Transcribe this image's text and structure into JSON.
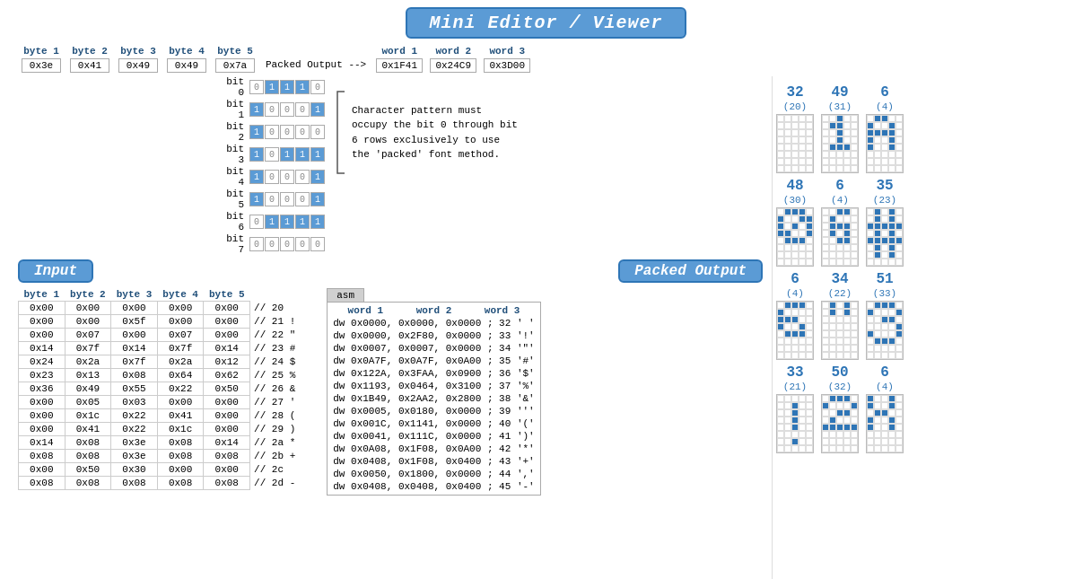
{
  "title": "Mini Editor / Viewer",
  "header": {
    "byte_labels": [
      "byte 1",
      "byte 2",
      "byte 3",
      "byte 4",
      "byte 5"
    ],
    "byte_values": [
      "0x3e",
      "0x41",
      "0x49",
      "0x49",
      "0x7a"
    ],
    "packed_arrow": "Packed Output -->",
    "word_labels": [
      "word 1",
      "word 2",
      "word 3"
    ],
    "word_values": [
      "0x1F41",
      "0x24C9",
      "0x3D00"
    ]
  },
  "bit_grid": {
    "rows": [
      {
        "label": "bit 0",
        "cells": [
          0,
          1,
          1,
          1,
          0
        ]
      },
      {
        "label": "bit 1",
        "cells": [
          1,
          0,
          0,
          0,
          1
        ]
      },
      {
        "label": "bit 2",
        "cells": [
          1,
          0,
          0,
          0,
          0
        ]
      },
      {
        "label": "bit 3",
        "cells": [
          1,
          0,
          1,
          1,
          1
        ]
      },
      {
        "label": "bit 4",
        "cells": [
          1,
          0,
          0,
          0,
          1
        ]
      },
      {
        "label": "bit 5",
        "cells": [
          1,
          0,
          0,
          0,
          1
        ]
      },
      {
        "label": "bit 6",
        "cells": [
          0,
          1,
          1,
          1,
          1
        ]
      },
      {
        "label": "bit 7",
        "cells": [
          0,
          0,
          0,
          0,
          0
        ]
      }
    ]
  },
  "annotation": "Character pattern must occupy the bit 0 through bit 6 rows exclusively to use the 'packed' font method.",
  "input_label": "Input",
  "packed_output_label": "Packed Output",
  "input_table": {
    "col_headers": [
      "byte 1",
      "byte 2",
      "byte 3",
      "byte 4",
      "byte 5"
    ],
    "rows": [
      [
        "0x00",
        "0x00",
        "0x00",
        "0x00",
        "0x00",
        "// 20"
      ],
      [
        "0x00",
        "0x00",
        "0x5f",
        "0x00",
        "0x00",
        "// 21 !"
      ],
      [
        "0x00",
        "0x07",
        "0x00",
        "0x07",
        "0x00",
        "// 22 \""
      ],
      [
        "0x14",
        "0x7f",
        "0x14",
        "0x7f",
        "0x14",
        "// 23 #"
      ],
      [
        "0x24",
        "0x2a",
        "0x7f",
        "0x2a",
        "0x12",
        "// 24 $"
      ],
      [
        "0x23",
        "0x13",
        "0x08",
        "0x64",
        "0x62",
        "// 25 %"
      ],
      [
        "0x36",
        "0x49",
        "0x55",
        "0x22",
        "0x50",
        "// 26 &"
      ],
      [
        "0x00",
        "0x05",
        "0x03",
        "0x00",
        "0x00",
        "// 27 '"
      ],
      [
        "0x00",
        "0x1c",
        "0x22",
        "0x41",
        "0x00",
        "// 28 ("
      ],
      [
        "0x00",
        "0x41",
        "0x22",
        "0x1c",
        "0x00",
        "// 29 )"
      ],
      [
        "0x14",
        "0x08",
        "0x3e",
        "0x08",
        "0x14",
        "// 2a *"
      ],
      [
        "0x08",
        "0x08",
        "0x3e",
        "0x08",
        "0x08",
        "// 2b +"
      ],
      [
        "0x00",
        "0x50",
        "0x30",
        "0x00",
        "0x00",
        "// 2c"
      ],
      [
        "0x08",
        "0x08",
        "0x08",
        "0x08",
        "0x08",
        "// 2d -"
      ]
    ]
  },
  "packed_table": {
    "col_headers": [
      "word 1",
      "word 2",
      "word 3"
    ],
    "rows": [
      "dw 0x0000, 0x0000, 0x0000 ; 32 ' '",
      "dw 0x0000, 0x2F80, 0x0000 ; 33 '!'",
      "dw 0x0007, 0x0007, 0x0000 ; 34 '\"'",
      "dw 0x0A7F, 0x0A7F, 0x0A00 ; 35 '#'",
      "dw 0x122A, 0x3FAA, 0x0900 ; 36 '$'",
      "dw 0x1193, 0x0464, 0x3100 ; 37 '%'",
      "dw 0x1B49, 0x2AA2, 0x2800 ; 38 '&'",
      "dw 0x0005, 0x0180, 0x0000 ; 39 '''",
      "dw 0x001C, 0x1141, 0x0000 ; 40 '('",
      "dw 0x0041, 0x111C, 0x0000 ; 41 ')'",
      "dw 0x0A08, 0x1F08, 0x0A00 ; 42 '*'",
      "dw 0x0408, 0x1F08, 0x0400 ; 43 '+'",
      "dw 0x0050, 0x1800, 0x0000 ; 44 ','",
      "dw 0x0408, 0x0408, 0x0400 ; 45 '-'"
    ]
  },
  "char_previews": [
    {
      "label": "32",
      "sub": "(20)",
      "pixels": [
        [
          0,
          0,
          0,
          0,
          0
        ],
        [
          0,
          0,
          0,
          0,
          0
        ],
        [
          0,
          0,
          0,
          0,
          0
        ],
        [
          0,
          0,
          0,
          0,
          0
        ],
        [
          0,
          0,
          0,
          0,
          0
        ],
        [
          0,
          0,
          0,
          0,
          0
        ],
        [
          0,
          0,
          0,
          0,
          0
        ],
        [
          0,
          0,
          0,
          0,
          0
        ]
      ]
    },
    {
      "label": "48",
      "sub": "(30)",
      "pixels": [
        [
          0,
          1,
          1,
          1,
          0
        ],
        [
          1,
          0,
          0,
          1,
          1
        ],
        [
          1,
          0,
          1,
          0,
          1
        ],
        [
          1,
          1,
          0,
          0,
          1
        ],
        [
          0,
          1,
          1,
          1,
          0
        ],
        [
          0,
          0,
          0,
          0,
          0
        ],
        [
          0,
          0,
          0,
          0,
          0
        ],
        [
          0,
          0,
          0,
          0,
          0
        ]
      ]
    },
    {
      "label": "6",
      "sub": "(4)",
      "pixels": [
        [
          0,
          1,
          1,
          1,
          0
        ],
        [
          1,
          0,
          0,
          0,
          0
        ],
        [
          1,
          1,
          1,
          0,
          0
        ],
        [
          1,
          0,
          0,
          1,
          0
        ],
        [
          0,
          1,
          1,
          1,
          0
        ],
        [
          0,
          0,
          0,
          0,
          0
        ],
        [
          0,
          0,
          0,
          0,
          0
        ],
        [
          0,
          0,
          0,
          0,
          0
        ]
      ]
    },
    {
      "label": "33",
      "sub": "(21)",
      "pixels": [
        [
          0,
          0,
          0,
          0,
          0
        ],
        [
          0,
          0,
          1,
          0,
          0
        ],
        [
          0,
          0,
          1,
          0,
          0
        ],
        [
          0,
          0,
          1,
          0,
          0
        ],
        [
          0,
          0,
          1,
          0,
          0
        ],
        [
          0,
          0,
          0,
          0,
          0
        ],
        [
          0,
          0,
          1,
          0,
          0
        ],
        [
          0,
          0,
          0,
          0,
          0
        ]
      ]
    },
    {
      "label": "49",
      "sub": "(31)",
      "pixels": [
        [
          0,
          0,
          1,
          0,
          0
        ],
        [
          0,
          1,
          1,
          0,
          0
        ],
        [
          0,
          0,
          1,
          0,
          0
        ],
        [
          0,
          0,
          1,
          0,
          0
        ],
        [
          0,
          1,
          1,
          1,
          0
        ],
        [
          0,
          0,
          0,
          0,
          0
        ],
        [
          0,
          0,
          0,
          0,
          0
        ],
        [
          0,
          0,
          0,
          0,
          0
        ]
      ]
    },
    {
      "label": "6",
      "sub": "(4)",
      "pixels": [
        [
          0,
          0,
          1,
          1,
          0
        ],
        [
          0,
          1,
          0,
          0,
          0
        ],
        [
          0,
          1,
          1,
          1,
          0
        ],
        [
          0,
          1,
          0,
          1,
          0
        ],
        [
          0,
          0,
          1,
          1,
          0
        ],
        [
          0,
          0,
          0,
          0,
          0
        ],
        [
          0,
          0,
          0,
          0,
          0
        ],
        [
          0,
          0,
          0,
          0,
          0
        ]
      ]
    },
    {
      "label": "34",
      "sub": "(22)",
      "pixels": [
        [
          0,
          1,
          0,
          1,
          0
        ],
        [
          0,
          1,
          0,
          1,
          0
        ],
        [
          0,
          0,
          0,
          0,
          0
        ],
        [
          0,
          0,
          0,
          0,
          0
        ],
        [
          0,
          0,
          0,
          0,
          0
        ],
        [
          0,
          0,
          0,
          0,
          0
        ],
        [
          0,
          0,
          0,
          0,
          0
        ],
        [
          0,
          0,
          0,
          0,
          0
        ]
      ]
    },
    {
      "label": "50",
      "sub": "(32)",
      "pixels": [
        [
          0,
          1,
          1,
          1,
          0
        ],
        [
          1,
          0,
          0,
          0,
          1
        ],
        [
          0,
          0,
          1,
          1,
          0
        ],
        [
          0,
          1,
          0,
          0,
          0
        ],
        [
          1,
          1,
          1,
          1,
          1
        ],
        [
          0,
          0,
          0,
          0,
          0
        ],
        [
          0,
          0,
          0,
          0,
          0
        ],
        [
          0,
          0,
          0,
          0,
          0
        ]
      ]
    },
    {
      "label": "6",
      "sub": "(4)",
      "pixels": [
        [
          0,
          1,
          1,
          0,
          0
        ],
        [
          1,
          0,
          0,
          1,
          0
        ],
        [
          1,
          1,
          1,
          1,
          0
        ],
        [
          1,
          0,
          0,
          1,
          0
        ],
        [
          1,
          0,
          0,
          1,
          0
        ],
        [
          0,
          0,
          0,
          0,
          0
        ],
        [
          0,
          0,
          0,
          0,
          0
        ],
        [
          0,
          0,
          0,
          0,
          0
        ]
      ]
    },
    {
      "label": "35",
      "sub": "(23)",
      "pixels": [
        [
          0,
          1,
          0,
          1,
          0
        ],
        [
          0,
          1,
          0,
          1,
          0
        ],
        [
          1,
          1,
          1,
          1,
          1
        ],
        [
          0,
          1,
          0,
          1,
          0
        ],
        [
          1,
          1,
          1,
          1,
          1
        ],
        [
          0,
          1,
          0,
          1,
          0
        ],
        [
          0,
          1,
          0,
          1,
          0
        ],
        [
          0,
          0,
          0,
          0,
          0
        ]
      ]
    },
    {
      "label": "51",
      "sub": "(33)",
      "pixels": [
        [
          0,
          1,
          1,
          1,
          0
        ],
        [
          1,
          0,
          0,
          0,
          1
        ],
        [
          0,
          0,
          1,
          1,
          0
        ],
        [
          0,
          0,
          0,
          0,
          1
        ],
        [
          1,
          0,
          0,
          0,
          1
        ],
        [
          0,
          1,
          1,
          1,
          0
        ],
        [
          0,
          0,
          0,
          0,
          0
        ],
        [
          0,
          0,
          0,
          0,
          0
        ]
      ]
    },
    {
      "label": "6",
      "sub": "(4)",
      "pixels": [
        [
          1,
          0,
          0,
          1,
          0
        ],
        [
          1,
          0,
          0,
          1,
          0
        ],
        [
          0,
          1,
          1,
          0,
          0
        ],
        [
          1,
          0,
          0,
          1,
          0
        ],
        [
          1,
          0,
          0,
          1,
          0
        ],
        [
          0,
          0,
          0,
          0,
          0
        ],
        [
          0,
          0,
          0,
          0,
          0
        ],
        [
          0,
          0,
          0,
          0,
          0
        ]
      ]
    }
  ]
}
